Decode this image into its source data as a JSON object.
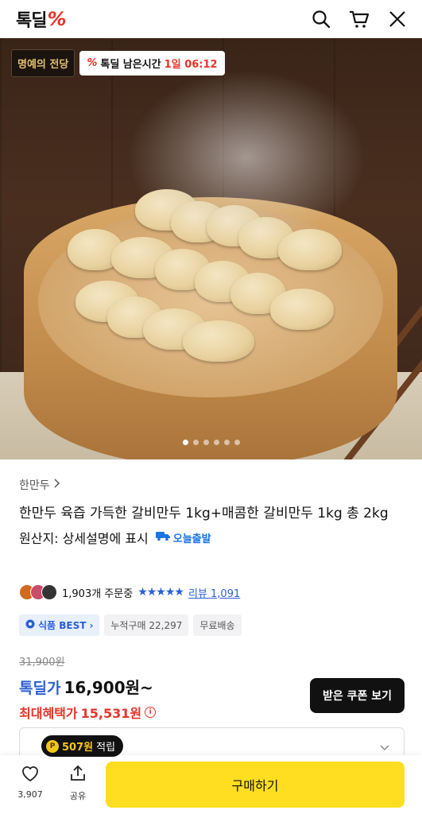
{
  "header": {
    "logo_text": "톡딜",
    "logo_mark": "%"
  },
  "hero": {
    "fame_badge": "명예의 전당",
    "timer_label": "톡딜 남은시간",
    "timer_value": "1일 06:12",
    "carousel_count": 6,
    "carousel_active": 1
  },
  "product": {
    "brand": "한만두",
    "title": "한만두 육즙 가득한 갈비만두 1kg+매콤한 갈비만두 1kg 총 2kg",
    "origin": "원산지: 상세설명에 표시",
    "delivery_badge": "오늘출발",
    "order_count": "1,903개 주문중",
    "stars": "★★★★★",
    "review_label": "리뷰 1,091"
  },
  "tags": {
    "best": "식품 BEST",
    "cumulative": "누적구매 22,297",
    "shipping": "무료배송"
  },
  "price": {
    "original": "31,900원",
    "deal_label": "톡딜가",
    "deal_value": "16,900원~",
    "max_label": "최대혜택가",
    "max_value": "15,531원",
    "info_icon": "i"
  },
  "coupon_button": "받은 쿠폰 보기",
  "points_tip": {
    "coin": "P",
    "amount": "507원",
    "suffix": "적립"
  },
  "bottom": {
    "like_count": "3,907",
    "share_label": "공유",
    "buy_label": "구매하기"
  },
  "colors": {
    "accent_red": "#e8332a",
    "accent_blue": "#2c5fd4",
    "buy_yellow": "#ffde21"
  }
}
